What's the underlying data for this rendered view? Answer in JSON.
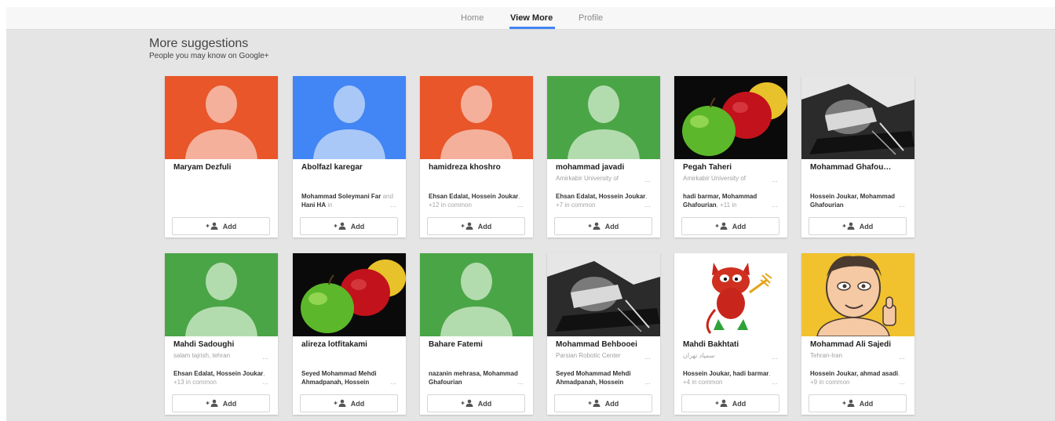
{
  "nav": {
    "tabs": [
      {
        "label": "Home",
        "active": false
      },
      {
        "label": "View More",
        "active": true
      },
      {
        "label": "Profile",
        "active": false
      }
    ],
    "accent_color": "#4285f4"
  },
  "section": {
    "title": "More suggestions",
    "subtitle": "People you may know on Google+"
  },
  "add_label": "Add",
  "people": [
    {
      "name": "Maryam Dezfuli",
      "detail": "",
      "common_parts": [],
      "photo": {
        "type": "silhouette",
        "bg": "#e8562a",
        "fg": "#f4b09b"
      }
    },
    {
      "name": "Abolfazl karegar",
      "detail": "",
      "common_parts": [
        [
          "Mohammad Soleymani Far",
          "b"
        ],
        [
          " and ",
          "m"
        ],
        [
          "Hani HA",
          "b"
        ],
        [
          " in",
          "m"
        ]
      ],
      "photo": {
        "type": "silhouette",
        "bg": "#4285f4",
        "fg": "#a9c8f8"
      }
    },
    {
      "name": "hamidreza khoshro",
      "detail": "",
      "common_parts": [
        [
          "Ehsan Edalat",
          "b"
        ],
        [
          ", ",
          "b"
        ],
        [
          "Hossein Joukar",
          "b"
        ],
        [
          ", +12 in common",
          "m"
        ]
      ],
      "photo": {
        "type": "silhouette",
        "bg": "#e8562a",
        "fg": "#f4b09b"
      }
    },
    {
      "name": "mohammad javadi",
      "detail": "Amirkabir University of",
      "common_parts": [
        [
          "Ehsan Edalat",
          "b"
        ],
        [
          ", ",
          "b"
        ],
        [
          "Hossein Joukar",
          "b"
        ],
        [
          ", +7 in common",
          "m"
        ]
      ],
      "photo": {
        "type": "silhouette",
        "bg": "#4aa546",
        "fg": "#b3dcae"
      }
    },
    {
      "name": "Pegah Taheri",
      "detail": "Amirkabir University of",
      "common_parts": [
        [
          "hadi barmar",
          "b"
        ],
        [
          ", ",
          "b"
        ],
        [
          "Mohammad Ghafourian",
          "b"
        ],
        [
          ", +11 in",
          "m"
        ]
      ],
      "photo": {
        "type": "apples"
      }
    },
    {
      "name": "Mohammad Ghafou…",
      "detail": "",
      "common_parts": [
        [
          "Hossein Joukar",
          "b"
        ],
        [
          ", ",
          "b"
        ],
        [
          "Mohammad Ghafourian",
          "b"
        ]
      ],
      "photo": {
        "type": "bw"
      }
    },
    {
      "name": "Mahdi Sadoughi",
      "detail": "salam tajrish, tehran",
      "common_parts": [
        [
          "Ehsan Edalat",
          "b"
        ],
        [
          ", ",
          "b"
        ],
        [
          "Hossein Joukar",
          "b"
        ],
        [
          ", +13 in common",
          "m"
        ]
      ],
      "photo": {
        "type": "silhouette",
        "bg": "#4aa546",
        "fg": "#b3dcae"
      }
    },
    {
      "name": "alireza lotfitakami",
      "detail": "",
      "common_parts": [
        [
          "Seyed Mohammad Mehdi Ahmadpanah",
          "b"
        ],
        [
          ", ",
          "b"
        ],
        [
          "Hossein",
          "b"
        ]
      ],
      "photo": {
        "type": "apples"
      }
    },
    {
      "name": "Bahare Fatemi",
      "detail": "",
      "common_parts": [
        [
          "nazanin mehrasa",
          "b"
        ],
        [
          ", ",
          "b"
        ],
        [
          "Mohammad Ghafourian",
          "b"
        ]
      ],
      "photo": {
        "type": "silhouette",
        "bg": "#4aa546",
        "fg": "#b3dcae"
      }
    },
    {
      "name": "Mohammad Behbooei",
      "detail": "Parsian Robotic Center",
      "common_parts": [
        [
          "Seyed Mohammad Mehdi Ahmadpanah",
          "b"
        ],
        [
          ", ",
          "b"
        ],
        [
          "Hossein",
          "b"
        ]
      ],
      "photo": {
        "type": "bw"
      }
    },
    {
      "name": "Mahdi Bakhtati",
      "detail": "سمپاد تهران",
      "common_parts": [
        [
          "Hossein Joukar",
          "b"
        ],
        [
          ", ",
          "b"
        ],
        [
          "hadi barmar",
          "b"
        ],
        [
          ", +4 in common",
          "m"
        ]
      ],
      "photo": {
        "type": "devil"
      }
    },
    {
      "name": "Mohammad Ali Sajedi",
      "detail": "Tehran-Iran",
      "common_parts": [
        [
          "Hossein Joukar",
          "b"
        ],
        [
          ", ",
          "b"
        ],
        [
          "ahmad asadi",
          "b"
        ],
        [
          ", +9 in common",
          "m"
        ]
      ],
      "photo": {
        "type": "cartoon"
      }
    }
  ]
}
